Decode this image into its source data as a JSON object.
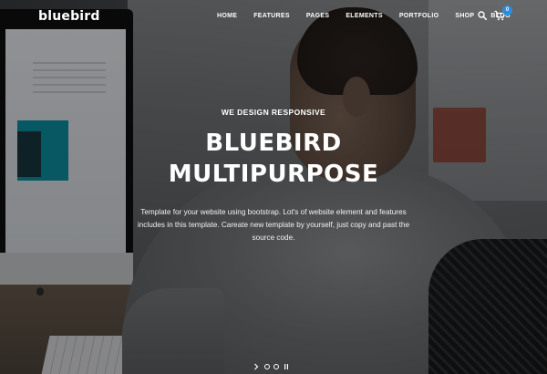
{
  "brand": {
    "logo_text": "bluebird"
  },
  "nav": {
    "items": [
      {
        "label": "HOME"
      },
      {
        "label": "FEATURES"
      },
      {
        "label": "PAGES"
      },
      {
        "label": "ELEMENTS"
      },
      {
        "label": "PORTFOLIO"
      },
      {
        "label": "SHOP"
      },
      {
        "label": "BLOG"
      }
    ],
    "icons": [
      "search-icon",
      "shopping-cart-icon"
    ],
    "cart_count": "0"
  },
  "hero": {
    "eyebrow": "WE DESIGN RESPONSIVE",
    "headline_line1": "BLUEBIRD",
    "headline_line2": "MULTIPURPOSE",
    "description": "Template for your website using bootstrap. Lot's of website element and features includes in this template. Careate new template by yourself, just copy and past the source code."
  },
  "slider": {
    "icons": [
      "arrow-right-icon",
      "pause-icon"
    ],
    "dot_count": 2
  },
  "colors": {
    "text": "#ffffff",
    "badge": "#2b8de0"
  }
}
